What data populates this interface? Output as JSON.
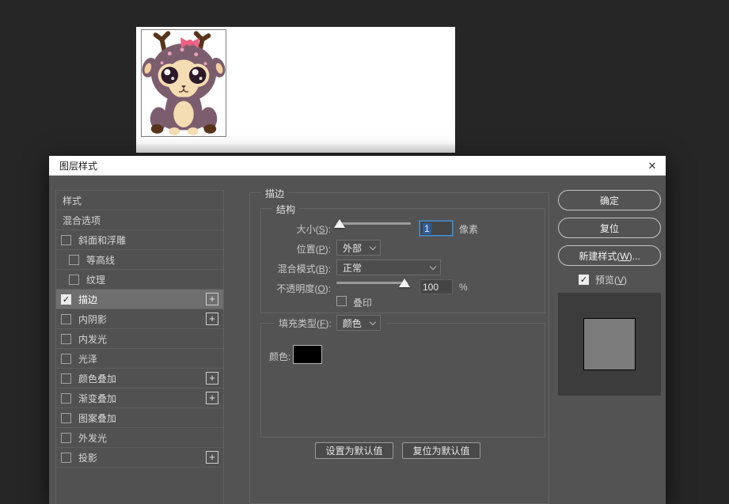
{
  "window": {
    "title": "图层样式"
  },
  "icons": {
    "close": "✕",
    "check": "✓",
    "plus": "+"
  },
  "canvas": {
    "image_name": "plush-deer-photo"
  },
  "sidebar": {
    "items": [
      {
        "label": "样式",
        "checkbox": false,
        "checked": false,
        "plus": false,
        "selected": false
      },
      {
        "label": "混合选项",
        "checkbox": false,
        "checked": false,
        "plus": false,
        "selected": false
      },
      {
        "label": "斜面和浮雕",
        "checkbox": true,
        "checked": false,
        "plus": false,
        "selected": false
      },
      {
        "label": "等高线",
        "checkbox": true,
        "checked": false,
        "plus": false,
        "selected": false,
        "indent": true
      },
      {
        "label": "纹理",
        "checkbox": true,
        "checked": false,
        "plus": false,
        "selected": false,
        "indent": true
      },
      {
        "label": "描边",
        "checkbox": true,
        "checked": true,
        "plus": true,
        "selected": true
      },
      {
        "label": "内阴影",
        "checkbox": true,
        "checked": false,
        "plus": true,
        "selected": false
      },
      {
        "label": "内发光",
        "checkbox": true,
        "checked": false,
        "plus": false,
        "selected": false
      },
      {
        "label": "光泽",
        "checkbox": true,
        "checked": false,
        "plus": false,
        "selected": false
      },
      {
        "label": "颜色叠加",
        "checkbox": true,
        "checked": false,
        "plus": true,
        "selected": false
      },
      {
        "label": "渐变叠加",
        "checkbox": true,
        "checked": false,
        "plus": true,
        "selected": false
      },
      {
        "label": "图案叠加",
        "checkbox": true,
        "checked": false,
        "plus": false,
        "selected": false
      },
      {
        "label": "外发光",
        "checkbox": true,
        "checked": false,
        "plus": false,
        "selected": false
      },
      {
        "label": "投影",
        "checkbox": true,
        "checked": false,
        "plus": true,
        "selected": false
      }
    ]
  },
  "panel": {
    "group_title": "描边",
    "structure": {
      "title": "结构",
      "size_label": "大小(S):",
      "size_value": "1",
      "size_unit": "像素",
      "position_label": "位置(P):",
      "position_value": "外部",
      "blend_label": "混合模式(B):",
      "blend_value": "正常",
      "opacity_label": "不透明度(O):",
      "opacity_value": "100",
      "opacity_unit": "%",
      "overprint_label": "叠印",
      "overprint_checked": false
    },
    "fill": {
      "type_label": "填充类型(F):",
      "type_value": "颜色",
      "color_label": "颜色:",
      "color_value": "#000000"
    },
    "buttons": {
      "make_default": "设置为默认值",
      "reset_default": "复位为默认值"
    }
  },
  "actions": {
    "ok": "确定",
    "reset": "复位",
    "new_style": "新建样式(W)...",
    "preview_label": "预览(V)",
    "preview_checked": true
  },
  "colors": {
    "dialog_bg": "#535353",
    "app_bg": "#262626",
    "focus_accent": "#3f8fd4",
    "text_selection": "#2e5f9e",
    "stroke_color_swatch": "#000000",
    "preview_square": "#7b7b7b"
  }
}
